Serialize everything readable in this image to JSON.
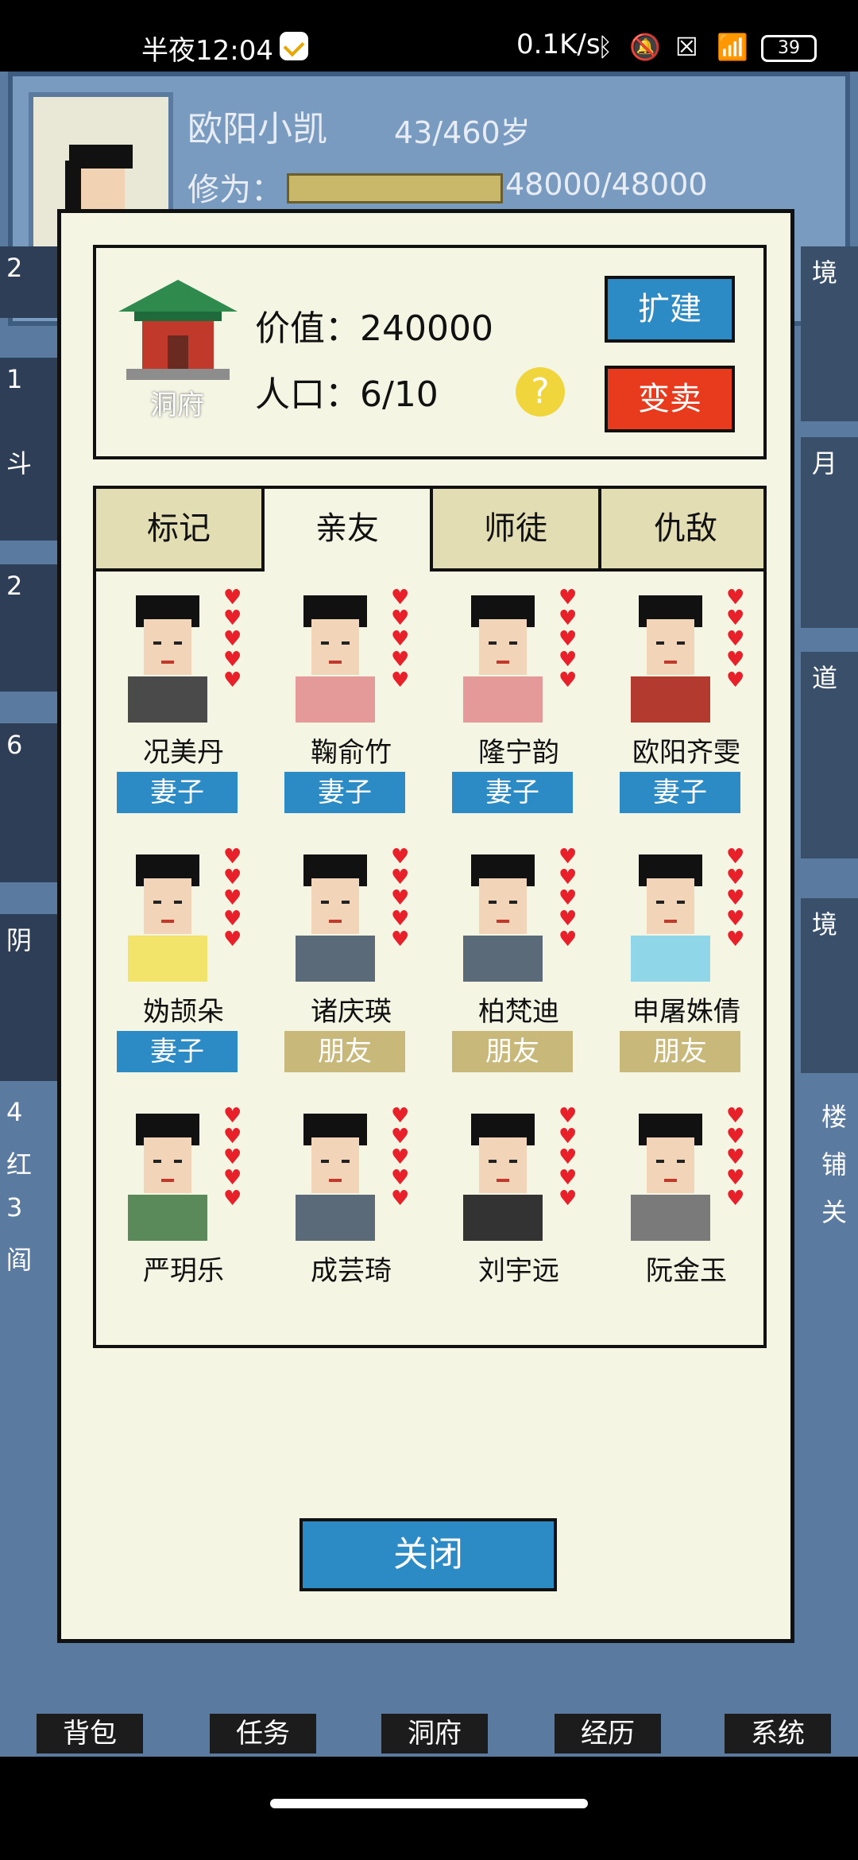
{
  "status_bar": {
    "time": "半夜12:04",
    "net_speed": "0.1K/s",
    "battery": "39",
    "icons": [
      "check-app-icon",
      "bluetooth-icon",
      "mute-icon",
      "sim-off-icon",
      "wifi-icon",
      "battery-icon"
    ]
  },
  "hero": {
    "name": "欧阳小凯",
    "age": "43/460岁",
    "cultivation_label": "修为：",
    "cultivation_value": "48000/48000",
    "cultivation_fraction": 1.0
  },
  "side_left_labels": [
    "2",
    "1",
    "斗",
    "2",
    "6",
    "阴",
    "4",
    "红",
    "3",
    "阎"
  ],
  "side_right_labels": [
    "境",
    "月",
    "道",
    "境",
    "楼",
    "铺",
    "关"
  ],
  "bottom_nav": [
    "背包",
    "任务",
    "洞府",
    "经历",
    "系统"
  ],
  "dialog": {
    "residence": {
      "label": "洞府",
      "value_text": "价值：240000",
      "population_text": "人口：6/10",
      "help": "?",
      "expand_button": "扩建",
      "sell_button": "变卖"
    },
    "tabs": [
      "标记",
      "亲友",
      "师徒",
      "仇敌"
    ],
    "active_tab": "亲友",
    "characters": [
      {
        "name": "况美丹",
        "relation": "妻子",
        "type": "wife",
        "hearts": 5
      },
      {
        "name": "鞠俞竹",
        "relation": "妻子",
        "type": "wife",
        "hearts": 5
      },
      {
        "name": "隆宁韵",
        "relation": "妻子",
        "type": "wife",
        "hearts": 5
      },
      {
        "name": "欧阳齐雯",
        "relation": "妻子",
        "type": "wife",
        "hearts": 5
      },
      {
        "name": "妫颉朵",
        "relation": "妻子",
        "type": "wife",
        "hearts": 5
      },
      {
        "name": "诸庆瑛",
        "relation": "朋友",
        "type": "friend",
        "hearts": 5
      },
      {
        "name": "柏梵迪",
        "relation": "朋友",
        "type": "friend",
        "hearts": 5
      },
      {
        "name": "申屠姝倩",
        "relation": "朋友",
        "type": "friend",
        "hearts": 5
      },
      {
        "name": "严玥乐",
        "relation": "",
        "type": "",
        "hearts": 5
      },
      {
        "name": "成芸琦",
        "relation": "",
        "type": "",
        "hearts": 5
      },
      {
        "name": "刘宇远",
        "relation": "",
        "type": "",
        "hearts": 5
      },
      {
        "name": "阮金玉",
        "relation": "",
        "type": "",
        "hearts": 5
      }
    ],
    "close_button": "关闭"
  },
  "colors": {
    "dialog_bg": "#f5f5e4",
    "wife_badge": "#2c8bc4",
    "friend_badge": "#c8b87a",
    "sell": "#e83a1c",
    "heart": "#e8202a"
  }
}
